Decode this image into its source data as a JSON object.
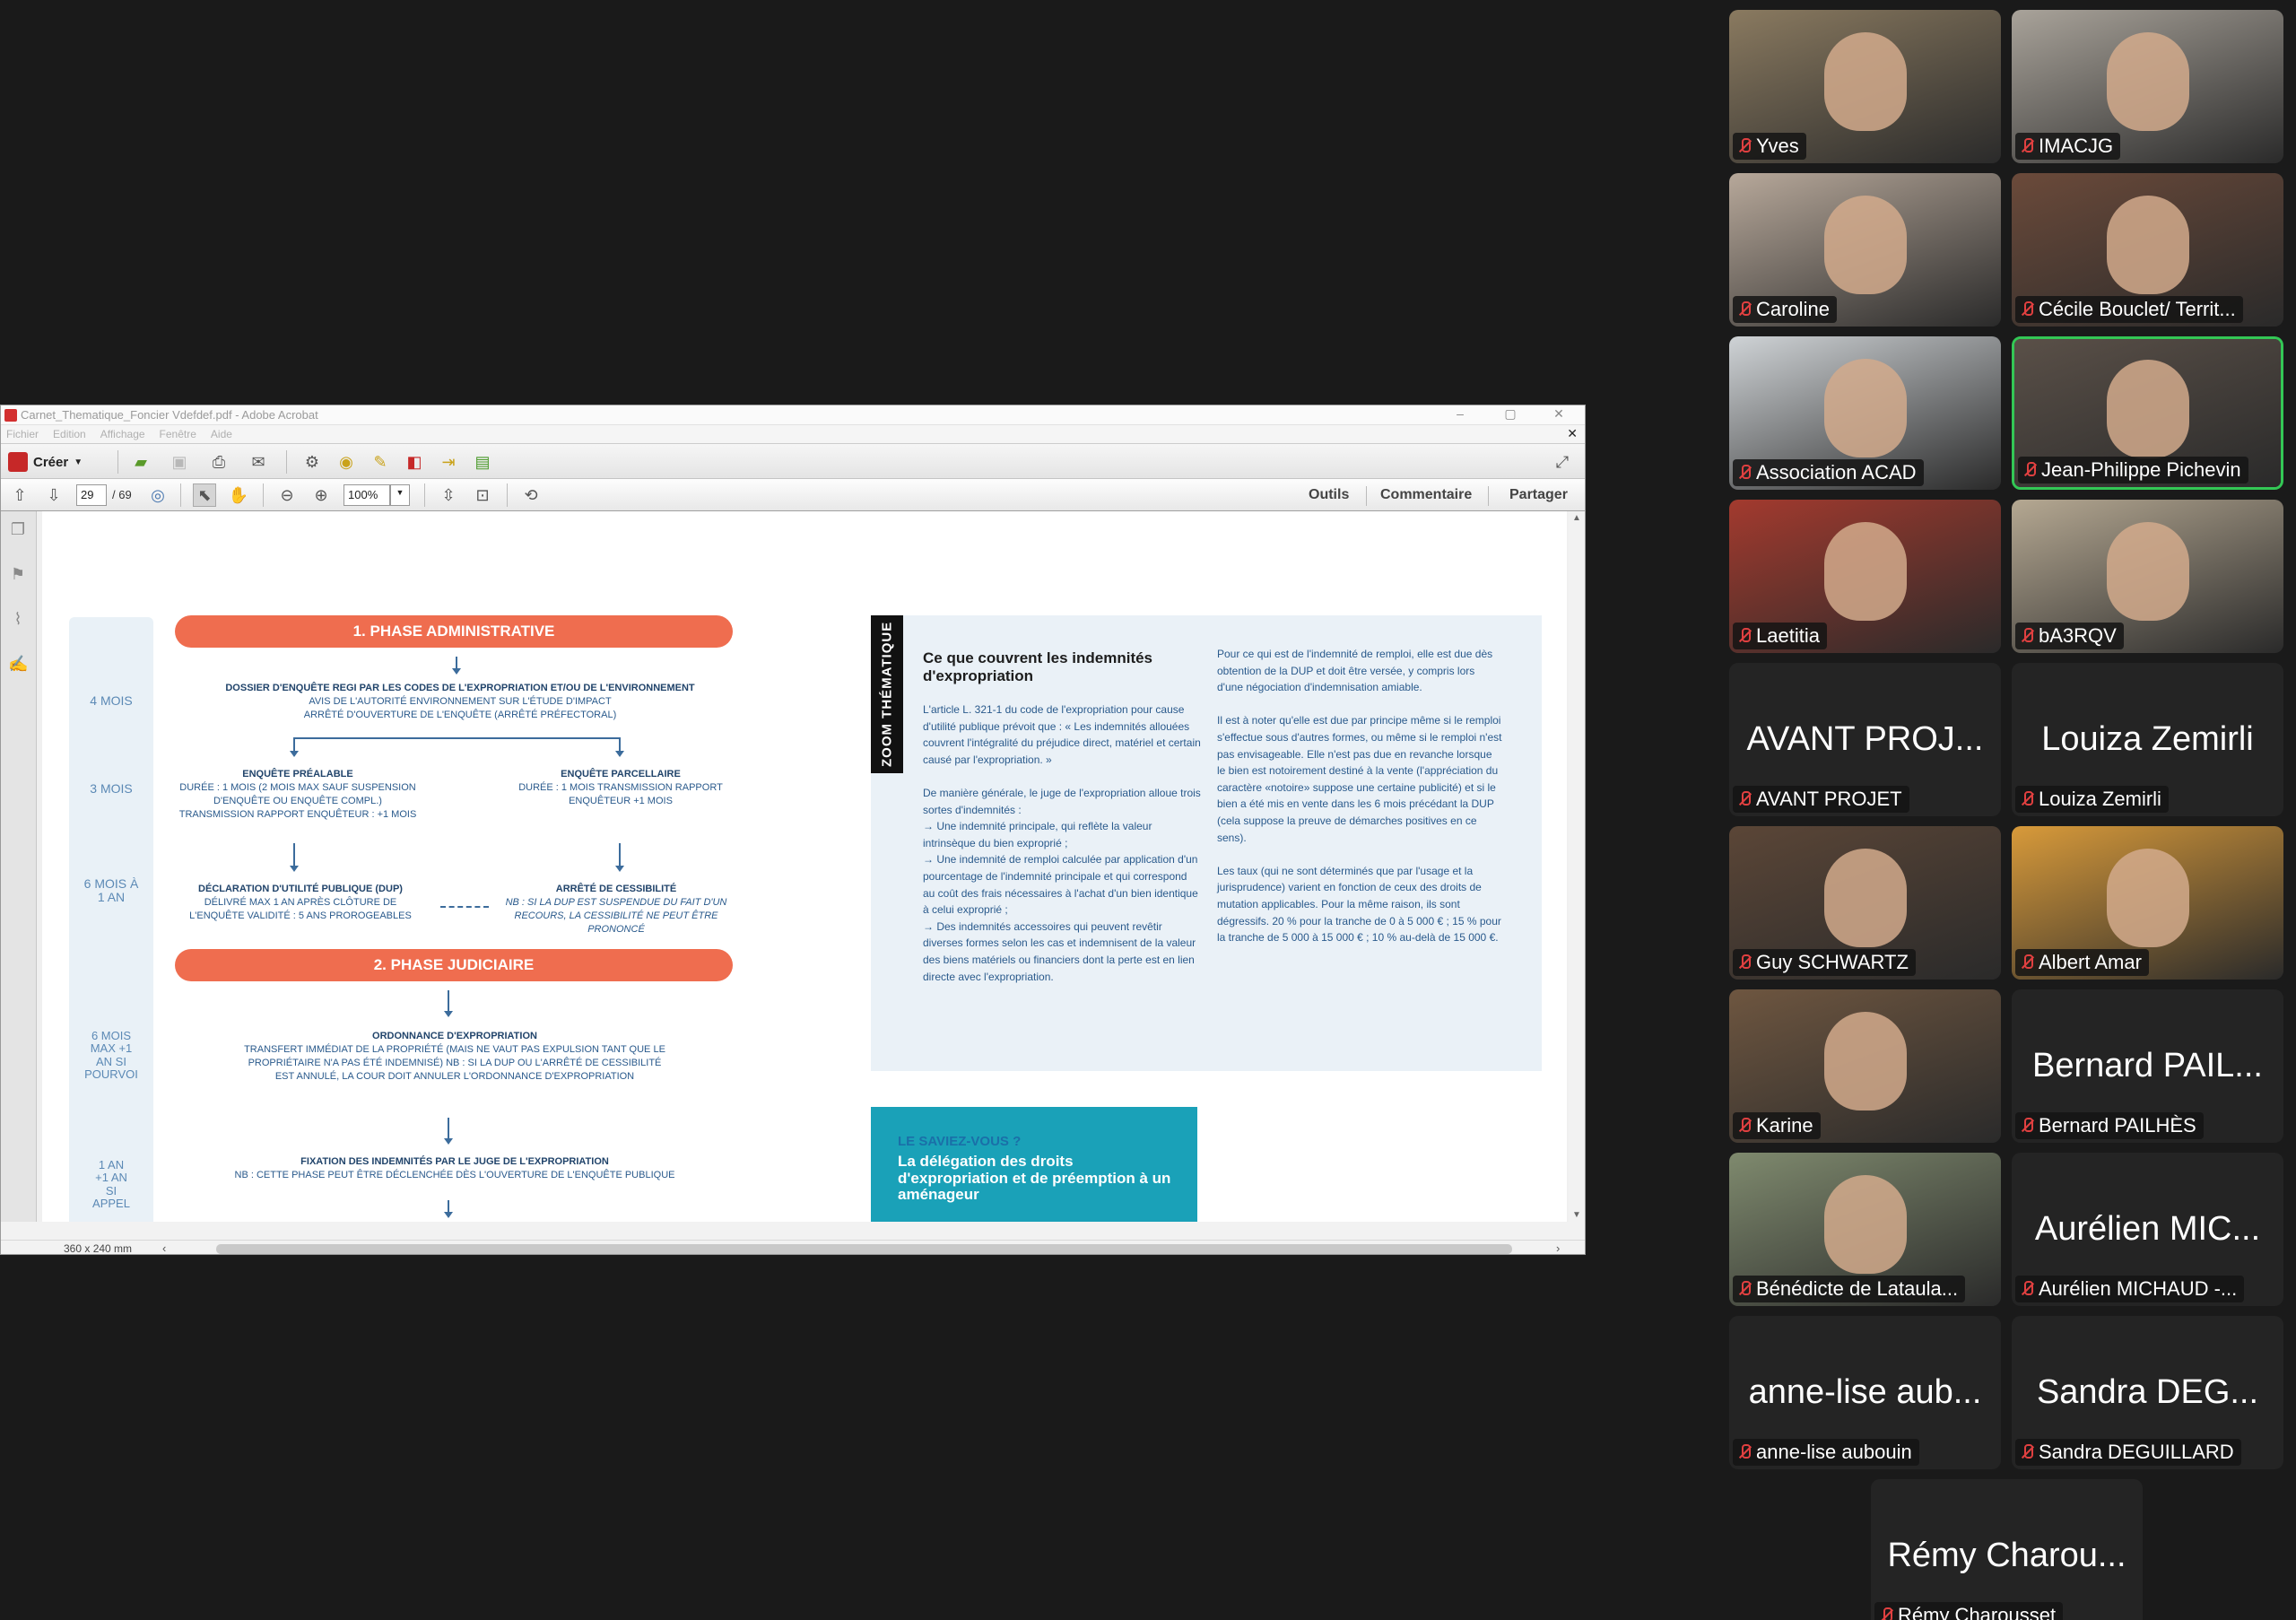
{
  "acrobat": {
    "title": "Carnet_Thematique_Foncier Vdefdef.pdf - Adobe Acrobat",
    "menu": [
      "Fichier",
      "Edition",
      "Affichage",
      "Fenêtre",
      "Aide"
    ],
    "creer_label": "Créer",
    "page_current": "29",
    "page_total": "/ 69",
    "zoom": "100%",
    "right_links": [
      "Outils",
      "Commentaire",
      "Partager"
    ],
    "page_size": "360 x 240 mm"
  },
  "pdf": {
    "timeline": [
      "4 MOIS",
      "3 MOIS",
      "6 MOIS À 1 AN",
      "6 MOIS MAX +1 AN SI POURVOI",
      "1 AN +1 AN SI APPEL"
    ],
    "phase1": "1. PHASE ADMINISTRATIVE",
    "phase2": "2. PHASE JUDICIAIRE",
    "dossier_title": "DOSSIER D'ENQUÊTE REGI PAR LES CODES DE L'EXPROPRIATION ET/OU DE L'ENVIRONNEMENT",
    "dossier_body": "AVIS DE L'AUTORITÉ ENVIRONNEMENT SUR L'ÉTUDE D'IMPACT ARRÊTÉ D'OUVERTURE DE L'ENQUÊTE (ARRÊTÉ PRÉFECTORAL)",
    "enq_prealable_title": "ENQUÊTE PRÉALABLE",
    "enq_prealable_body": "DURÉE : 1 MOIS (2 MOIS MAX SAUF SUSPENSION D'ENQUÊTE OU ENQUÊTE COMPL.) TRANSMISSION RAPPORT ENQUÊTEUR : +1 MOIS",
    "enq_parcellaire_title": "ENQUÊTE PARCELLAIRE",
    "enq_parcellaire_body": "DURÉE : 1 MOIS TRANSMISSION RAPPORT ENQUÊTEUR +1 MOIS",
    "dup_title": "DÉCLARATION D'UTILITÉ PUBLIQUE (DUP)",
    "dup_body": "DÉLIVRÉ MAX 1 AN APRÈS CLÔTURE DE L'ENQUÊTE VALIDITÉ : 5 ANS PROROGEABLES",
    "cess_title": "ARRÊTÉ DE CESSIBILITÉ",
    "cess_body": "NB : SI LA DUP EST SUSPENDUE DU FAIT D'UN RECOURS, LA CESSIBILITÉ NE PEUT ÊTRE PRONONCÉ",
    "ordo_title": "ORDONNANCE D'EXPROPRIATION",
    "ordo_body": "TRANSFERT IMMÉDIAT DE LA PROPRIÉTÉ (MAIS NE VAUT PAS EXPULSION TANT QUE LE PROPRIÉTAIRE N'A PAS ÉTÉ INDEMNISÉ) NB : SI LA DUP OU L'ARRÊTÉ DE CESSIBILITÉ EST ANNULÉ, LA COUR DOIT ANNULER L'ORDONNANCE D'EXPROPRIATION",
    "fix_title": "FIXATION DES INDEMNITÉS PAR LE JUGE DE L'EXPROPRIATION",
    "fix_body": "NB : CETTE PHASE PEUT ÊTRE DÉCLENCHÉE DÈS L'OUVERTURE DE L'ENQUÊTE PUBLIQUE",
    "zoom_tag": "ZOOM THÉMATIQUE",
    "zoom_title": "Ce que couvrent les indemnités d'expropriation",
    "zoom_col1": "L'article L. 321-1 du code de l'expropriation pour cause d'utilité publique prévoit que : « Les indemnités allouées couvrent l'intégralité du préjudice direct, matériel et certain causé par l'expropriation. »\n\nDe manière générale, le juge de l'expropriation alloue trois sortes d'indemnités :\n→ Une indemnité principale, qui reflète la valeur intrinsèque du bien exproprié ;\n→ Une indemnité de remploi calculée par application d'un pourcentage de l'indemnité principale et qui correspond au coût des frais nécessaires à l'achat d'un bien identique à celui exproprié ;\n→ Des indemnités accessoires qui peuvent revêtir diverses formes selon les cas et indemnisent de la valeur des biens matériels ou financiers dont la perte est en lien directe avec l'expropriation.",
    "zoom_col2": "Pour ce qui est de l'indemnité de remploi, elle est due dès obtention de la DUP et doit être versée, y compris lors d'une négociation d'indemnisation amiable.\n\nIl est à noter qu'elle est due par principe même si le remploi s'effectue sous d'autres formes, ou même si le remploi n'est pas envisageable. Elle n'est pas due en revanche lorsque le bien est notoirement destiné à la vente (l'appréciation du caractère «notoire» suppose une certaine publicité) et si le bien a été mis en vente dans les 6 mois précédant la DUP (cela suppose la preuve de démarches positives en ce sens).\n\nLes taux (qui ne sont déterminés que par l'usage et la jurisprudence) varient en fonction de ceux des droits de mutation applicables. Pour la même raison, ils sont dégressifs. 20 % pour la tranche de 0 à 5 000 € ; 15 % pour la tranche de 5 000 à 15 000 € ; 10 % au-delà de 15 000 €.",
    "saviez_head": "LE SAVIEZ-VOUS ?",
    "saviez_body": "La délégation des droits d'expropriation et de préemption à un aménageur"
  },
  "participants": [
    {
      "name": "Yves",
      "video": true,
      "bg": "#8a7a60"
    },
    {
      "name": "IMACJG",
      "video": true,
      "bg": "#a9a39a"
    },
    {
      "name": "Caroline",
      "video": true,
      "bg": "#b7a89a"
    },
    {
      "name": "Cécile Bouclet/ Territ...",
      "video": true,
      "bg": "#6b4a3a"
    },
    {
      "name": "Association ACAD",
      "video": true,
      "bg": "#cfd3d6"
    },
    {
      "name": "Jean-Philippe Pichevin",
      "video": true,
      "bg": "#5a5048",
      "active": true
    },
    {
      "name": "Laetitia",
      "video": true,
      "bg": "#a33a2e"
    },
    {
      "name": "bA3RQV",
      "video": true,
      "bg": "#b5a892"
    },
    {
      "name": "AVANT PROJET",
      "big": "AVANT PROJ...",
      "video": false
    },
    {
      "name": "Louiza Zemirli",
      "big": "Louiza Zemirli",
      "video": false
    },
    {
      "name": "Guy SCHWARTZ",
      "video": true,
      "bg": "#5b4637"
    },
    {
      "name": "Albert Amar",
      "video": true,
      "bg": "#d89a3a"
    },
    {
      "name": "Karine",
      "video": true,
      "bg": "#6e5640"
    },
    {
      "name": "Bernard PAILHÈS",
      "big": "Bernard PAIL...",
      "video": false
    },
    {
      "name": "Bénédicte de Lataula...",
      "video": true,
      "bg": "#7f8a6e"
    },
    {
      "name": "Aurélien MICHAUD -...",
      "big": "Aurélien MIC...",
      "video": false
    },
    {
      "name": "anne-lise aubouin",
      "big": "anne-lise aub...",
      "video": false
    },
    {
      "name": "Sandra DEGUILLARD",
      "big": "Sandra DEG...",
      "video": false
    },
    {
      "name": "Rémy Charousset",
      "big": "Rémy Charou...",
      "video": false
    }
  ]
}
